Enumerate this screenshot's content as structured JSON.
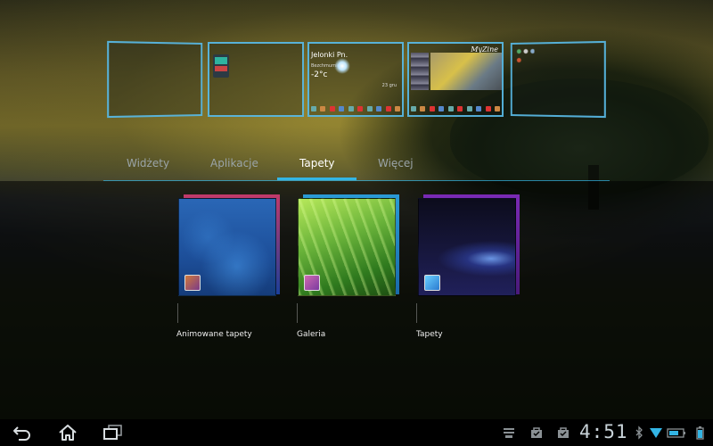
{
  "home_previews": {
    "weather": {
      "city": "Jelonki Pn.",
      "description": "Bezchmurnie",
      "temperature": "-2°c",
      "date": "23 gru"
    },
    "myzine": {
      "title": "MyZine"
    }
  },
  "tabs": [
    {
      "label": "Widżety"
    },
    {
      "label": "Aplikacje"
    },
    {
      "label": "Tapety",
      "selected": true
    },
    {
      "label": "Więcej"
    }
  ],
  "wallpaper_sources": [
    {
      "label": "Animowane tapety",
      "icon": "live-wallpaper-icon"
    },
    {
      "label": "Galeria",
      "icon": "gallery-icon"
    },
    {
      "label": "Tapety",
      "icon": "wallpapers-icon"
    }
  ],
  "system_bar": {
    "clock": "4:51",
    "nav": [
      "back-icon",
      "home-icon",
      "recent-apps-icon"
    ],
    "status_icons": [
      "usb-icon",
      "shopping-bag-icon",
      "shopping-bag-icon",
      "bluetooth-icon",
      "wifi-icon",
      "dock-battery-icon",
      "battery-icon"
    ]
  },
  "colors": {
    "accent": "#33b5e5",
    "tab_inactive": "#9aa4a8",
    "preview_border": "#5abeeb"
  }
}
